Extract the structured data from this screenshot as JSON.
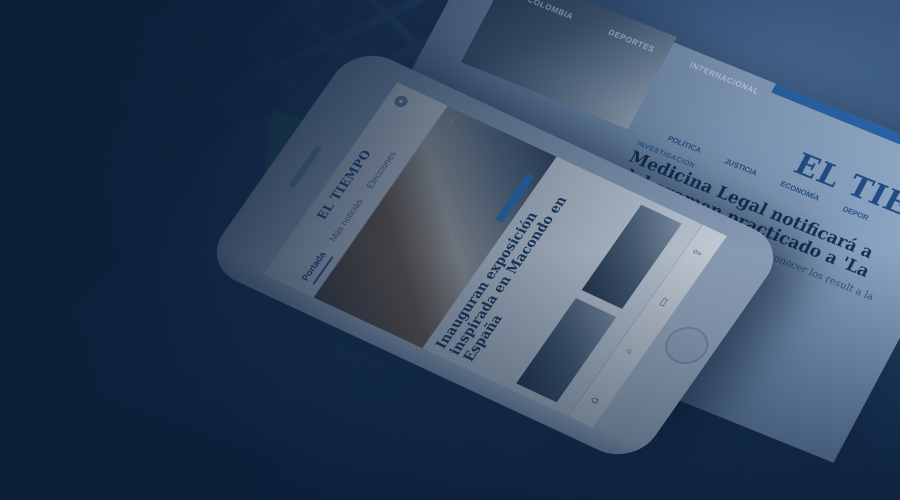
{
  "desktop": {
    "nav": [
      "COLOMBIA",
      "DEPORTES",
      "INTERNACIONAL"
    ],
    "logo": "EL TIEMPO",
    "subnav": [
      "POLÍTICA",
      "JUSTICIA",
      "ECONOMÍA",
      "DEPOR"
    ],
    "kicker": "INVESTIGACIÓN",
    "headline": "Medicina Legal notificará a",
    "headline2": "del examen practicado a 'La",
    "summary": "Este viernes el organismo dará a conocer los result a la evaluación clínica."
  },
  "laptop_thumb_caption": "",
  "phone": {
    "logo": "EL TIEMPO",
    "tabs": [
      "Portada",
      "Más noticias",
      "Elecciones"
    ],
    "hero_menu": "...",
    "article_section": "",
    "article_title": "Inauguran exposición inspirada en Macondo en España",
    "article_summary": ""
  },
  "colors": {
    "brand": "#23528f",
    "accent": "#2f6bb3",
    "overlay": "#0b1f38"
  }
}
